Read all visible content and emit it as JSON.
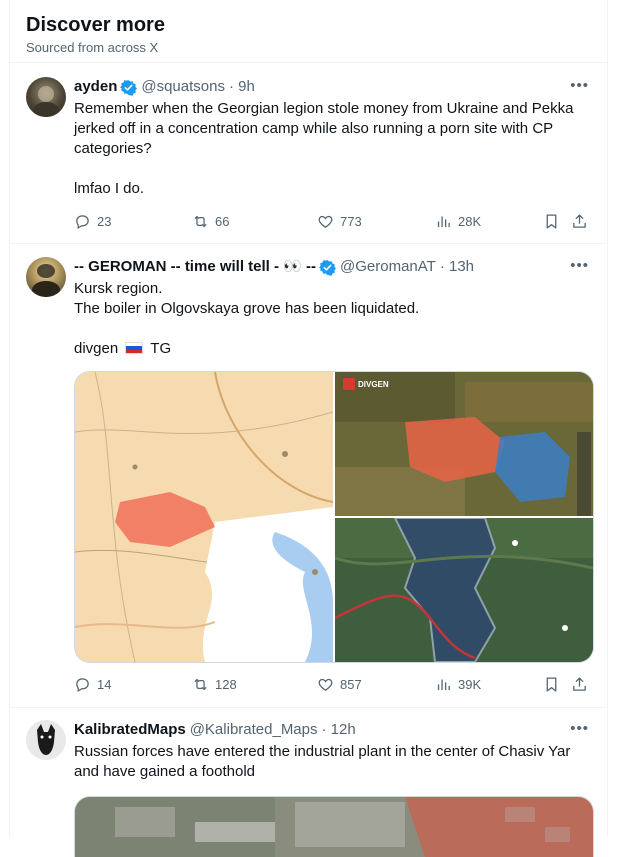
{
  "header": {
    "title": "Discover more",
    "subtitle": "Sourced from across X"
  },
  "posts": [
    {
      "name": "ayden",
      "handle": "@squatsons",
      "time": "· 9h",
      "text": "Remember when the Georgian legion stole money from Ukraine and Pekka jerked off in a concentration camp while also running a porn site with CP categories?\n\nlmfao I do.",
      "replies": "23",
      "reposts": "66",
      "likes": "773",
      "views": "28K"
    },
    {
      "name": "-- GEROMAN -- time will tell - 👀 --",
      "handle": "@GeromanAT",
      "time": "· 13h",
      "text_line1": "Kursk region.",
      "text_line2": "The boiler in Olgovskaya grove has been liquidated.",
      "text_prefix": "divgen",
      "text_suffix": "TG",
      "media_logo": "DIVGEN",
      "replies": "14",
      "reposts": "128",
      "likes": "857",
      "views": "39K"
    },
    {
      "name": "KalibratedMaps",
      "handle": "@Kalibrated_Maps",
      "time": "· 12h",
      "text": "Russian forces have entered the industrial plant in the center of Chasiv Yar and have gained a foothold"
    }
  ],
  "colors": {
    "verified": "#1d9bf0",
    "secondary_text": "#536471",
    "border": "#cfd9de"
  },
  "icons": [
    "reply-icon",
    "repost-icon",
    "like-icon",
    "views-icon",
    "bookmark-icon",
    "share-icon",
    "more-icon",
    "verified-badge-icon",
    "russia-flag-icon"
  ]
}
